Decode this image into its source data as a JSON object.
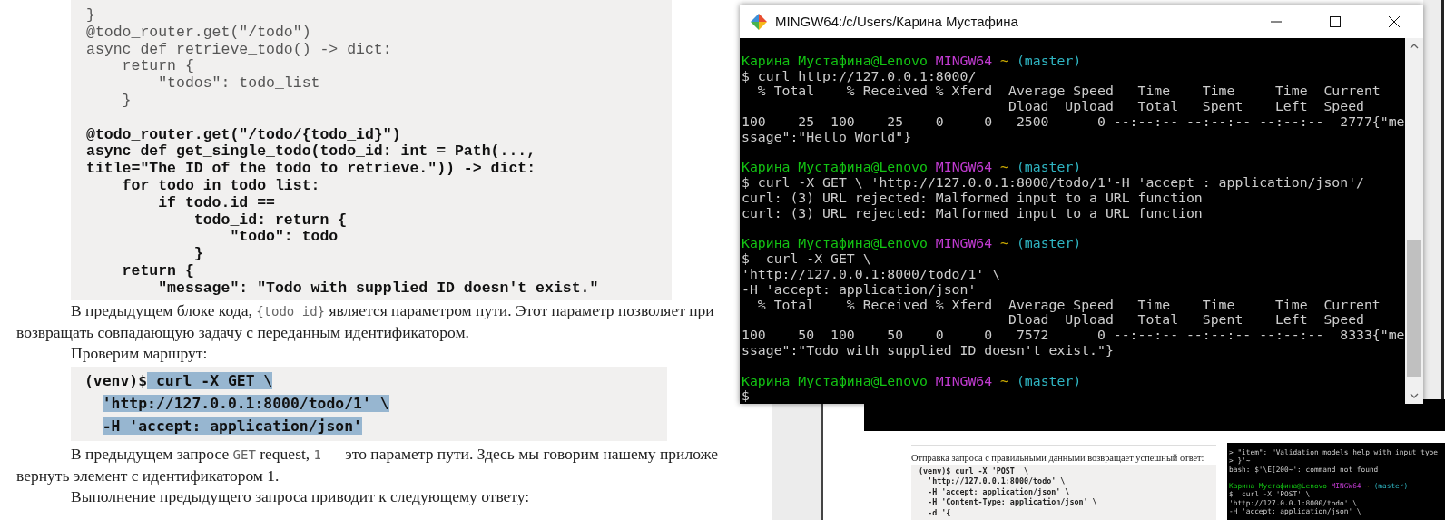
{
  "document": {
    "content": [
      {
        "kind": "code",
        "lines": [
          {
            "text": "}",
            "bold": false
          },
          {
            "text": "@todo_router.get(\"/todo\")",
            "bold": false
          },
          {
            "text": "async def retrieve_todo() -> dict:",
            "bold": false
          },
          {
            "text": "    return {",
            "bold": false
          },
          {
            "text": "        \"todos\": todo_list",
            "bold": false
          },
          {
            "text": "    }",
            "bold": false
          },
          {
            "kind": "blank"
          },
          {
            "text": "@todo_router.get(\"/todo/{todo_id}\")",
            "bold": true
          },
          {
            "text": "async def get_single_todo(todo_id: int = Path(...,",
            "bold": true
          },
          {
            "text": "title=\"The ID of the todo to retrieve.\")) -> dict:",
            "bold": true
          },
          {
            "text": "    for todo in todo_list:",
            "bold": true
          },
          {
            "text": "        if todo.id ==",
            "bold": true
          },
          {
            "text": "            todo_id: return {",
            "bold": true
          },
          {
            "text": "                \"todo\": todo",
            "bold": true
          },
          {
            "text": "            }",
            "bold": true
          },
          {
            "text": "    return {",
            "bold": true
          },
          {
            "text": "        \"message\": \"Todo with supplied ID doesn't exist.\"",
            "bold": true
          }
        ]
      },
      {
        "kind": "paragraph",
        "lines": [
          [
            {
              "text": "В предыдущем блоке кода, ",
              "code": false
            },
            {
              "text": "{todo_id}",
              "code": true
            },
            {
              "text": " является параметром пути. Этот параметр позволяет при",
              "code": false
            }
          ],
          [
            {
              "text": "возвращать совпадающую задачу с переданным идентификатором.",
              "code": false
            }
          ]
        ]
      },
      {
        "kind": "paragraph",
        "lines": [
          [
            {
              "text": "Проверим маршрут:",
              "code": false
            }
          ]
        ]
      },
      {
        "kind": "command",
        "lines": [
          {
            "indented": false,
            "segments": [
              {
                "text": "(venv)$",
                "selected": false
              },
              {
                "text": " curl -X GET \\",
                "selected": true
              }
            ]
          },
          {
            "indented": true,
            "segments": [
              {
                "text": "'http://127.0.0.1:8000/todo/1' \\",
                "selected": true
              }
            ]
          },
          {
            "indented": true,
            "segments": [
              {
                "text": "-H 'accept: application/json'",
                "selected": true
              }
            ]
          }
        ]
      },
      {
        "kind": "paragraph",
        "lines": [
          [
            {
              "text": "В предыдущем запросе ",
              "code": false
            },
            {
              "text": "GET",
              "code": true
            },
            {
              "text": " request, ",
              "code": false
            },
            {
              "text": "1",
              "code": true
            },
            {
              "text": " — это параметр пути. Здесь мы говорим нашему приложе",
              "code": false
            }
          ],
          [
            {
              "text": "вернуть элемент с идентификатором 1.",
              "code": false
            }
          ]
        ]
      },
      {
        "kind": "paragraph",
        "lines": [
          [
            {
              "text": "Выполнение предыдущего запроса приводит к следующему ответу:",
              "code": false
            }
          ]
        ]
      }
    ]
  },
  "terminal": {
    "title": "MINGW64:/c/Users/Карина Мустафина",
    "lines": [
      {
        "kind": "blank"
      },
      {
        "kind": "prompt",
        "user": "Карина Мустафина@Lenovo",
        "shell": "MINGW64",
        "path": "~",
        "branch": "(master)"
      },
      {
        "kind": "output",
        "text": "$ curl http://127.0.0.1:8000/"
      },
      {
        "kind": "output",
        "text": "  % Total    % Received % Xferd  Average Speed   Time    Time     Time  Current"
      },
      {
        "kind": "output",
        "text": "                                 Dload  Upload   Total   Spent    Left  Speed"
      },
      {
        "kind": "output",
        "text": "100    25  100    25    0     0   2500      0 --:--:-- --:--:-- --:--:--  2777{\"me"
      },
      {
        "kind": "output",
        "text": "ssage\":\"Hello World\"}"
      },
      {
        "kind": "blank"
      },
      {
        "kind": "prompt",
        "user": "Карина Мустафина@Lenovo",
        "shell": "MINGW64",
        "path": "~",
        "branch": "(master)"
      },
      {
        "kind": "output",
        "text": "$ curl -X GET \\ 'http://127.0.0.1:8000/todo/1'-H 'accept : application/json'/"
      },
      {
        "kind": "output",
        "text": "curl: (3) URL rejected: Malformed input to a URL function"
      },
      {
        "kind": "output",
        "text": "curl: (3) URL rejected: Malformed input to a URL function"
      },
      {
        "kind": "blank"
      },
      {
        "kind": "prompt",
        "user": "Карина Мустафина@Lenovo",
        "shell": "MINGW64",
        "path": "~",
        "branch": "(master)"
      },
      {
        "kind": "output",
        "text": "$  curl -X GET \\"
      },
      {
        "kind": "output",
        "text": "'http://127.0.0.1:8000/todo/1' \\"
      },
      {
        "kind": "output",
        "text": "-H 'accept: application/json'"
      },
      {
        "kind": "output",
        "text": "  % Total    % Received % Xferd  Average Speed   Time    Time     Time  Current"
      },
      {
        "kind": "output",
        "text": "                                 Dload  Upload   Total   Spent    Left  Speed"
      },
      {
        "kind": "output",
        "text": "100    50  100    50    0     0   7572      0 --:--:-- --:--:-- --:--:--  8333{\"me"
      },
      {
        "kind": "output",
        "text": "ssage\":\"Todo with supplied ID doesn't exist.\"}"
      },
      {
        "kind": "blank"
      },
      {
        "kind": "prompt",
        "user": "Карина Мустафина@Lenovo",
        "shell": "MINGW64",
        "path": "~",
        "branch": "(master)"
      },
      {
        "kind": "output",
        "text": "$"
      }
    ]
  },
  "preview_document": {
    "paragraph": "Отправка запроса с правильными данными возвращает успешный ответ:",
    "code_lines": [
      "(venv)$ curl -X 'POST' \\",
      "  'http://127.0.0.1:8000/todo' \\",
      "  -H 'accept: application/json' \\",
      "  -H 'Content-Type: application/json' \\",
      "  -d '{"
    ]
  },
  "preview_terminal": {
    "lines": [
      {
        "kind": "output",
        "text": "> \"item\": \"Validation models help with input type"
      },
      {
        "kind": "output",
        "text": "> }'~"
      },
      {
        "kind": "output",
        "text": "bash: $'\\E[200~': command not found"
      },
      {
        "kind": "blank"
      },
      {
        "kind": "prompt",
        "user": "Карина Мустафина@Lenovo",
        "shell": "MINGW64",
        "path": "~",
        "branch": "(master)"
      },
      {
        "kind": "output",
        "text": "$  curl -X 'POST' \\"
      },
      {
        "kind": "output",
        "text": "'http://127.0.0.1:8000/todo' \\"
      },
      {
        "kind": "output",
        "text": "-H 'accept: application/json' \\"
      }
    ]
  }
}
